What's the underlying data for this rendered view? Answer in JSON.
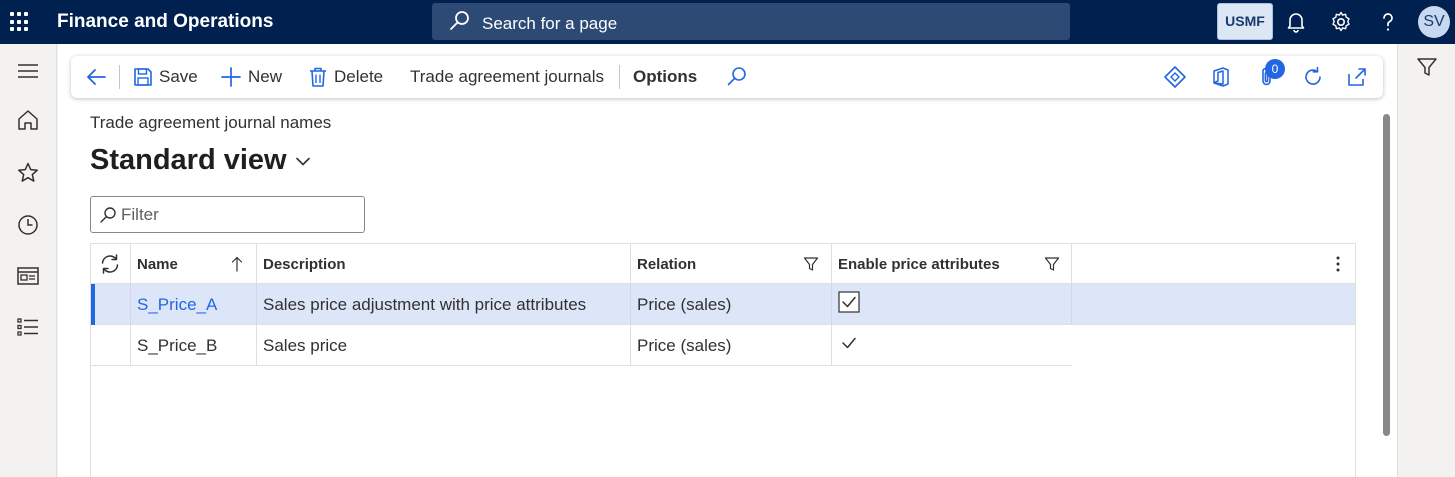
{
  "app": {
    "title": "Finance and Operations"
  },
  "search": {
    "placeholder": "Search for a page"
  },
  "company": "USMF",
  "user": {
    "initials": "SV"
  },
  "actions": {
    "save": "Save",
    "new": "New",
    "delete": "Delete",
    "journals": "Trade agreement journals",
    "options": "Options",
    "attachments_count": "0"
  },
  "page": {
    "caption": "Trade agreement journal names",
    "view_title": "Standard view"
  },
  "filter": {
    "placeholder": "Filter"
  },
  "grid": {
    "columns": [
      "Name",
      "Description",
      "Relation",
      "Enable price attributes"
    ],
    "rows": [
      {
        "name": "S_Price_A",
        "description": "Sales price adjustment with price attributes",
        "relation": "Price (sales)",
        "enable_price_attributes": true
      },
      {
        "name": "S_Price_B",
        "description": "Sales price",
        "relation": "Price (sales)",
        "enable_price_attributes": true
      }
    ]
  },
  "colors": {
    "nav": "#002050",
    "accent": "#2266e3",
    "selected_row": "#dce6f8"
  }
}
